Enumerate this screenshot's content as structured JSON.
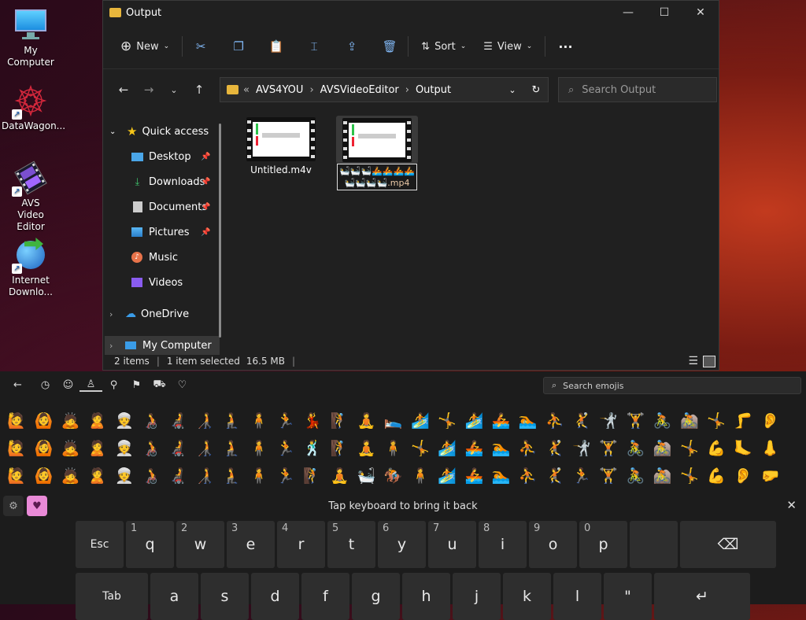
{
  "desktop": {
    "icons": [
      {
        "label": "My Computer"
      },
      {
        "label": "DataWagon..."
      },
      {
        "label": "AVS Video Editor"
      },
      {
        "label": "Internet Downlo..."
      }
    ]
  },
  "explorer": {
    "title": "Output",
    "toolbar": {
      "new_label": "New",
      "sort_label": "Sort",
      "view_label": "View",
      "more_label": "···"
    },
    "address": {
      "overflow": "«",
      "crumbs": [
        "AVS4YOU",
        "AVSVideoEditor",
        "Output"
      ],
      "separator": "›"
    },
    "search_placeholder": "Search Output",
    "nav": {
      "quick_access": "Quick access",
      "items": [
        {
          "label": "Desktop",
          "icon": "desktop-icon",
          "pinned": true
        },
        {
          "label": "Downloads",
          "icon": "downloads-icon",
          "pinned": true
        },
        {
          "label": "Documents",
          "icon": "documents-icon",
          "pinned": true
        },
        {
          "label": "Pictures",
          "icon": "pictures-icon",
          "pinned": true
        },
        {
          "label": "Music",
          "icon": "music-icon",
          "pinned": false
        },
        {
          "label": "Videos",
          "icon": "videos-icon",
          "pinned": false
        }
      ],
      "onedrive": "OneDrive",
      "my_computer": "My Computer"
    },
    "files": [
      {
        "name": "Untitled.m4v",
        "selected": false
      },
      {
        "name": "🛀🛀🛀🚣🚣🚣🚣🛀🛀🛀🛀.mp4",
        "selected": true
      }
    ],
    "status": {
      "count": "2 items",
      "selected": "1 item selected",
      "size": "16.5 MB"
    }
  },
  "emoji_panel": {
    "search_placeholder": "Search emojis",
    "categories": [
      "back-icon",
      "recent-icon",
      "smiley-icon",
      "people-icon",
      "places-icon",
      "flag-icon",
      "car-icon",
      "heart-icon"
    ],
    "rows": [
      [
        "🙋",
        "🙆",
        "🙇",
        "🙎",
        "👳",
        "🧑‍🦽",
        "🧑‍🦼",
        "🧑‍🦯",
        "🧎",
        "🧍",
        "🏃",
        "💃",
        "🧗",
        "🧘",
        "🛌",
        "🏄",
        "🤸",
        "🏄",
        "🚣",
        "🏊",
        "⛹",
        "🤾",
        "🤺",
        "🏋",
        "🚴",
        "🚵",
        "🤸",
        "🦵",
        "👂"
      ],
      [
        "🙋",
        "🙆",
        "🙇",
        "🙎",
        "👳",
        "🧑‍🦽",
        "🧑‍🦼",
        "🧑‍🦯",
        "🧎",
        "🧍",
        "🏃",
        "🕺",
        "🧗",
        "🧘",
        "🧍",
        "🤸",
        "🏄",
        "🚣",
        "🏊",
        "⛹",
        "🤾",
        "🤺",
        "🏋",
        "🚴",
        "🚵",
        "🤸",
        "💪",
        "🦶",
        "👃"
      ],
      [
        "🙋",
        "🙆",
        "🙇",
        "🙎",
        "👳",
        "🧑‍🦽",
        "🧑‍🦼",
        "🧑‍🦯",
        "🧎",
        "🧍",
        "🏃",
        "🧗",
        "🧘",
        "🛀",
        "🏇",
        "🧍",
        "🏄",
        "🚣",
        "🏊",
        "⛹",
        "🤾",
        "🏃",
        "🏋",
        "🚴",
        "🚵",
        "🤸",
        "💪",
        "👂",
        "🤛"
      ]
    ]
  },
  "keyboard": {
    "message": "Tap keyboard to bring it back",
    "row1": [
      {
        "label": "Esc",
        "alt": ""
      },
      {
        "label": "q",
        "alt": "1"
      },
      {
        "label": "w",
        "alt": "2"
      },
      {
        "label": "e",
        "alt": "3"
      },
      {
        "label": "r",
        "alt": "4"
      },
      {
        "label": "t",
        "alt": "5"
      },
      {
        "label": "y",
        "alt": "6"
      },
      {
        "label": "u",
        "alt": "7"
      },
      {
        "label": "i",
        "alt": "8"
      },
      {
        "label": "o",
        "alt": "9"
      },
      {
        "label": "p",
        "alt": "0"
      },
      {
        "label": "",
        "alt": ""
      },
      {
        "label": "⌫",
        "alt": ""
      }
    ],
    "row2": [
      {
        "label": "Tab",
        "alt": ""
      },
      {
        "label": "a",
        "alt": ""
      },
      {
        "label": "s",
        "alt": ""
      },
      {
        "label": "d",
        "alt": ""
      },
      {
        "label": "f",
        "alt": ""
      },
      {
        "label": "g",
        "alt": ""
      },
      {
        "label": "h",
        "alt": ""
      },
      {
        "label": "j",
        "alt": ""
      },
      {
        "label": "k",
        "alt": ""
      },
      {
        "label": "l",
        "alt": ""
      },
      {
        "label": "\"",
        "alt": ""
      },
      {
        "label": "↵",
        "alt": ""
      }
    ]
  },
  "colors": {
    "accent": "#0078d4",
    "selection": "#3a3a3a",
    "folder": "#e8b63c"
  }
}
